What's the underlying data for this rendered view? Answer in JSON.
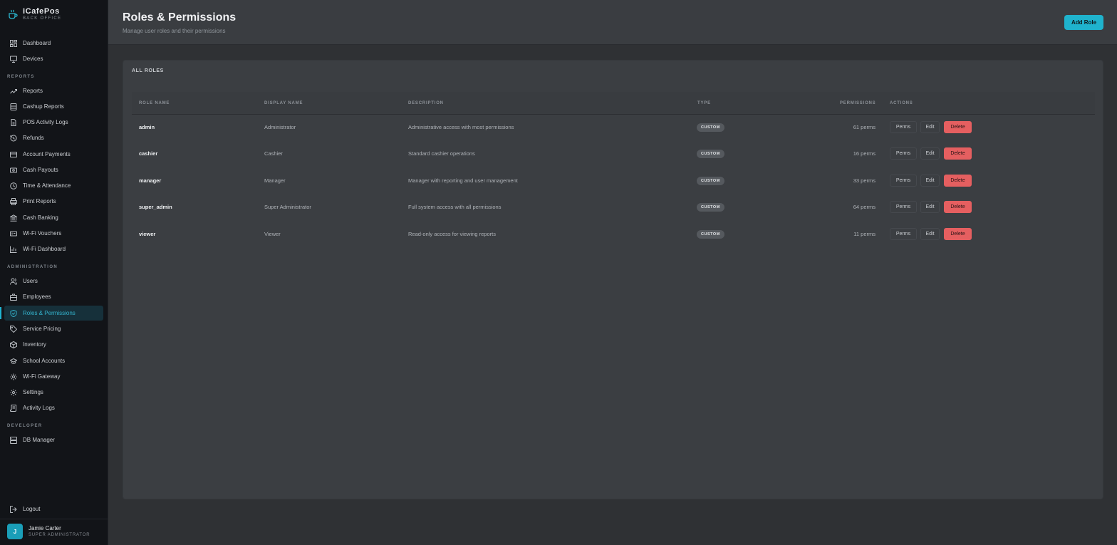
{
  "brand": {
    "name": "iCafePos",
    "subtitle": "BACK OFFICE"
  },
  "nav": {
    "dashboard": "Dashboard",
    "devices": "Devices",
    "section_reports": "REPORTS",
    "reports": "Reports",
    "cashup_reports": "Cashup Reports",
    "pos_activity_logs": "POS Activity Logs",
    "refunds": "Refunds",
    "account_payments": "Account Payments",
    "cash_payouts": "Cash Payouts",
    "time_attendance": "Time & Attendance",
    "print_reports": "Print Reports",
    "cash_banking": "Cash Banking",
    "wifi_vouchers": "Wi-Fi Vouchers",
    "wifi_dashboard": "Wi-Fi Dashboard",
    "section_administration": "ADMINISTRATION",
    "users": "Users",
    "employees": "Employees",
    "roles_permissions": "Roles & Permissions",
    "service_pricing": "Service Pricing",
    "inventory": "Inventory",
    "school_accounts": "School Accounts",
    "wifi_gateway": "Wi-Fi Gateway",
    "settings": "Settings",
    "activity_logs": "Activity Logs",
    "section_developer": "DEVELOPER",
    "db_manager": "DB Manager",
    "logout": "Logout"
  },
  "user": {
    "initial": "J",
    "name": "Jamie Carter",
    "role": "SUPER ADMINISTRATOR"
  },
  "header": {
    "title": "Roles & Permissions",
    "subtitle": "Manage user roles and their permissions",
    "add_role_label": "Add Role"
  },
  "card": {
    "title": "ALL ROLES"
  },
  "table": {
    "columns": {
      "role_name": "ROLE NAME",
      "display_name": "DISPLAY NAME",
      "description": "DESCRIPTION",
      "type": "TYPE",
      "permissions": "PERMISSIONS",
      "actions": "ACTIONS"
    },
    "actions": {
      "perms": "Perms",
      "edit": "Edit",
      "delete": "Delete"
    },
    "rows": [
      {
        "role_name": "admin",
        "display_name": "Administrator",
        "description": "Administrative access with most permissions",
        "type": "CUSTOM",
        "permissions": "61 perms"
      },
      {
        "role_name": "cashier",
        "display_name": "Cashier",
        "description": "Standard cashier operations",
        "type": "CUSTOM",
        "permissions": "16 perms"
      },
      {
        "role_name": "manager",
        "display_name": "Manager",
        "description": "Manager with reporting and user management",
        "type": "CUSTOM",
        "permissions": "33 perms"
      },
      {
        "role_name": "super_admin",
        "display_name": "Super Administrator",
        "description": "Full system access with all permissions",
        "type": "CUSTOM",
        "permissions": "64 perms"
      },
      {
        "role_name": "viewer",
        "display_name": "Viewer",
        "description": "Read-only access for viewing reports",
        "type": "CUSTOM",
        "permissions": "11 perms"
      }
    ]
  },
  "colors": {
    "accent": "#1fb3cd",
    "danger": "#e55f60",
    "sidebar_bg": "#121418",
    "page_bg": "#2f3134"
  }
}
